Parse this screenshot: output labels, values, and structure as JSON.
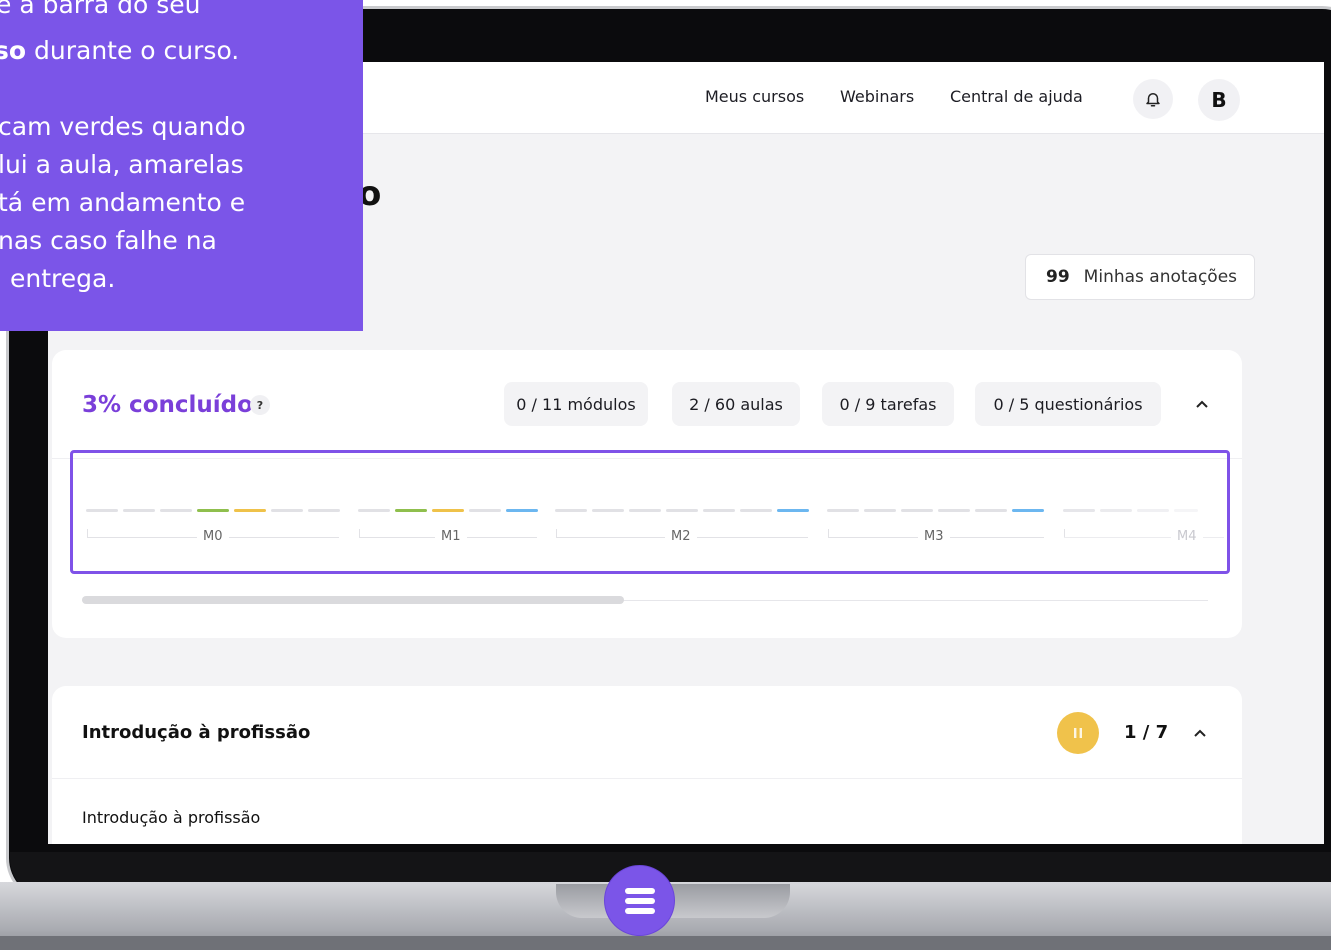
{
  "nav": {
    "links": [
      "Meus cursos",
      "Webinars",
      "Central de ajuda"
    ],
    "avatar_initial": "B"
  },
  "page": {
    "title_fragment": "o"
  },
  "notes_button": {
    "glyph": "99",
    "label": "Minhas anotações"
  },
  "progress": {
    "percent_label": "3% concluído",
    "help_glyph": "?",
    "stats": [
      "0 / 11 módulos",
      "2 / 60 aulas",
      "0 / 9 tarefas",
      "0 / 5 questionários"
    ],
    "modules": [
      "M0",
      "M1",
      "M2",
      "M3",
      "M4"
    ]
  },
  "module_section": {
    "title": "Introdução à profissão",
    "count": "1 / 7",
    "lesson": "Introdução à profissão"
  },
  "tooltip": {
    "lines": [
      "e a barra do seu",
      "durante o curso.",
      "cam verdes quando",
      "lui a aula, amarelas",
      "tá em andamento e",
      "nas caso falhe na",
      "entrega."
    ],
    "bold_fragment": "so"
  },
  "colors": {
    "accent": "#7b55e8",
    "percent": "#7a3fd9",
    "done": "#8fbf4d",
    "in_progress": "#efc24a",
    "current": "#6cb7f0",
    "pending": "#e1e1e5"
  }
}
